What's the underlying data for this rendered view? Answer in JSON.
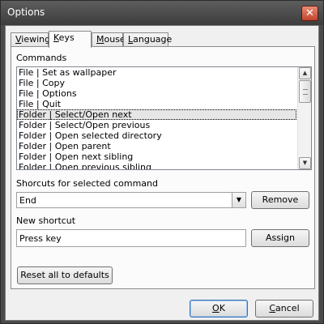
{
  "window": {
    "title": "Options",
    "close_glyph": "✕"
  },
  "tabs": [
    {
      "label": "Viewing",
      "mnemonic": "V",
      "rest": "iewing"
    },
    {
      "label": "Keys",
      "mnemonic": "K",
      "rest": "eys"
    },
    {
      "label": "Mouse",
      "mnemonic": "M",
      "rest": "ouse"
    },
    {
      "label": "Language",
      "mnemonic": "L",
      "rest": "anguage"
    }
  ],
  "active_tab": "Keys",
  "commands": {
    "label": "Commands",
    "items": [
      "File | Set as wallpaper",
      "File | Copy",
      "File | Options",
      "File | Quit",
      "Folder | Select/Open next",
      "Folder | Select/Open previous",
      "Folder | Open selected directory",
      "Folder | Open parent",
      "Folder | Open next sibling",
      "Folder | Open previous sibling"
    ],
    "selected_index": 4
  },
  "shortcuts": {
    "label": "Shorcuts for selected command",
    "selected_value": "End",
    "remove_label": "Remove"
  },
  "new_shortcut": {
    "label": "New shortcut",
    "value": "Press key",
    "assign_label": "Assign"
  },
  "reset_label": "Reset all to defaults",
  "footer": {
    "ok_label": "OK",
    "ok_mnemonic": "O",
    "ok_rest": "K",
    "cancel_label": "Cancel",
    "cancel_mnemonic": "C",
    "cancel_rest": "ancel"
  }
}
